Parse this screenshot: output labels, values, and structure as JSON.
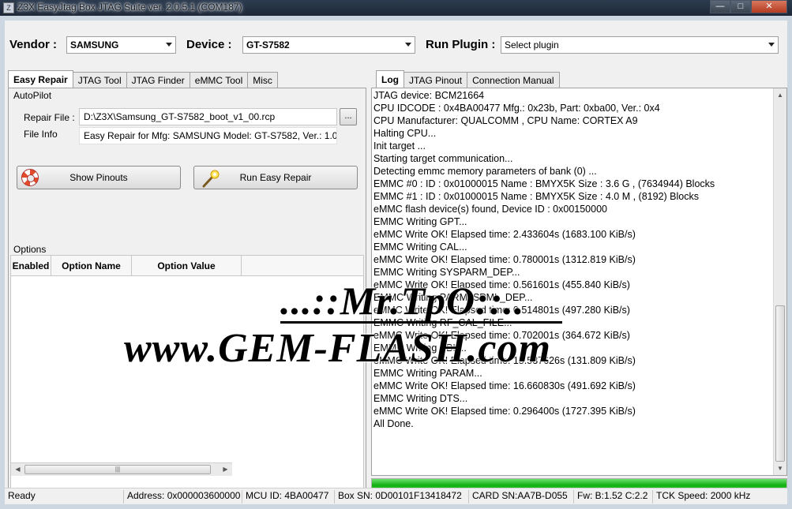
{
  "window": {
    "title": "Z3X EasyJtag Box JTAG Suite ver. 2.0.5.1 (COM187)",
    "icon": "app-icon",
    "controls": [
      "minimize-icon",
      "maximize-icon",
      "close-icon"
    ]
  },
  "top": {
    "vendor_label": "Vendor :",
    "vendor_value": "SAMSUNG",
    "device_label": "Device :",
    "device_value": "GT-S7582",
    "plugin_label": "Run Plugin :",
    "plugin_value": "Select plugin"
  },
  "left_tabs": [
    "Easy Repair",
    "JTAG Tool",
    "JTAG Finder",
    "eMMC Tool",
    "Misc"
  ],
  "autopilot": {
    "caption": "AutoPilot",
    "repair_file_label": "Repair File :",
    "repair_file_value": "D:\\Z3X\\Samsung_GT-S7582_boot_v1_00.rcp",
    "browse_label": "...",
    "file_info_label": "File Info",
    "file_info_value": "Easy Repair for Mfg: SAMSUNG Model: GT-S7582, Ver.: 1.00",
    "show_pinouts_label": "Show Pinouts",
    "run_easy_repair_label": "Run Easy Repair"
  },
  "options": {
    "caption": "Options",
    "columns": [
      "Enabled",
      "Option Name",
      "Option Value"
    ],
    "scroll_thumb": "|||"
  },
  "right_tabs": [
    "Log",
    "JTAG Pinout",
    "Connection Manual"
  ],
  "log_lines": [
    "JTAG device: BCM21664",
    "CPU IDCODE : 0x4BA00477 Mfg.: 0x23b, Part: 0xba00, Ver.: 0x4",
    "CPU Manufacturer: QUALCOMM , CPU Name: CORTEX A9",
    "Halting CPU...",
    "Init target ...",
    "Starting target communication...",
    "Detecting emmc memory parameters of bank (0) ...",
    "EMMC #0 : ID : 0x01000015 Name : BMYX5K Size : 3.6 G , (7634944) Blocks",
    "EMMC #1 : ID : 0x01000015 Name : BMYX5K Size : 4.0 M , (8192) Blocks",
    "eMMC flash device(s) found, Device ID : 0x00150000",
    "EMMC Writing GPT...",
    "eMMC Write OK! Elapsed time: 2.433604s (1683.100 KiB/s)",
    "EMMC Writing CAL...",
    "eMMC Write OK! Elapsed time: 0.780001s (1312.819 KiB/s)",
    "EMMC Writing SYSPARM_DEP...",
    "eMMC Write OK! Elapsed time: 0.561601s (455.840 KiB/s)",
    "EMMC Writing PARM_SPML_DEP...",
    "eMMC Write OK! Elapsed time: 0.514801s (497.280 KiB/s)",
    "EMMC Writing RF_CAL_FILE...",
    "eMMC Write OK! Elapsed time: 0.702001s (364.672 KiB/s)",
    "EMMC Writing SBL...",
    "eMMC Write OK! Elapsed time: 15.537626s (131.809 KiB/s)",
    "EMMC Writing PARAM...",
    "eMMC Write OK! Elapsed time: 16.660830s (491.692 KiB/s)",
    "EMMC Writing DTS...",
    "eMMC Write OK! Elapsed time: 0.296400s (1727.395 KiB/s)",
    "All Done."
  ],
  "progress_fraction": 1.0,
  "status": {
    "state": "Ready",
    "address": "Address: 0x000003600000",
    "mcu_id": "MCU ID: 4BA00477",
    "box_sn": "Box SN: 0D00101F13418472",
    "card_sn": "CARD SN:AA7B-D055",
    "fw": "Fw: B:1.52 C:2.2",
    "tck_speed": "TCK Speed: 2000 kHz"
  },
  "watermark": {
    "line1": "...::Mr.TpO::..",
    "line2": "www.GEM-FLASH.com"
  },
  "colors": {
    "progress": "#13b113",
    "frame": "#cdd7e2",
    "lifebuoy": "#e44b2a"
  }
}
